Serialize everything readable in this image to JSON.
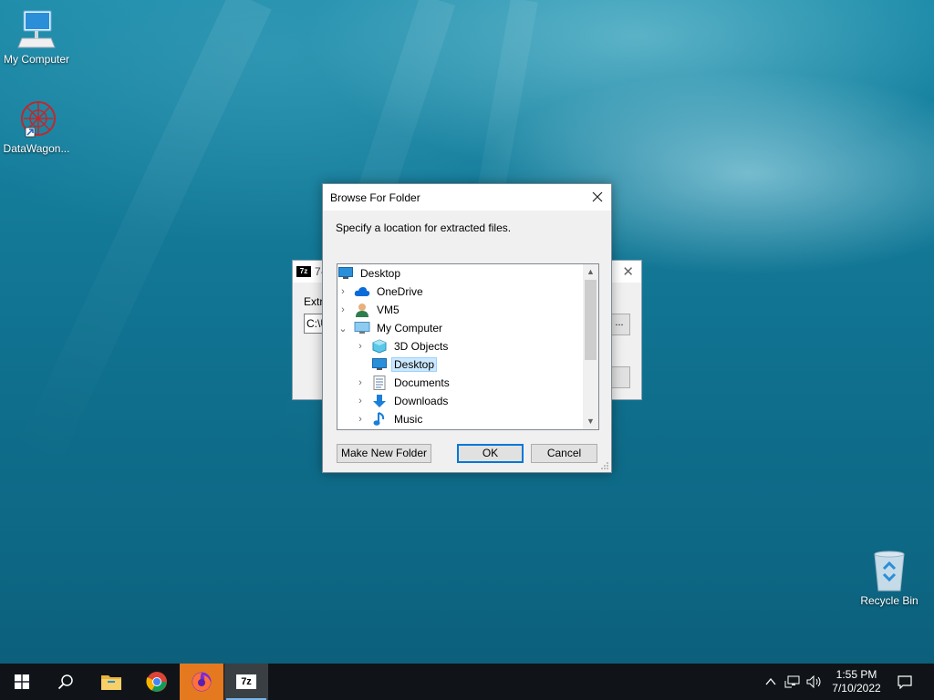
{
  "desktop": {
    "icons": [
      {
        "label": "My Computer",
        "icon": "computer-icon"
      },
      {
        "label": "DataWagon...",
        "icon": "datawagon-icon"
      },
      {
        "label": "Recycle Bin",
        "icon": "recycle-bin-icon"
      }
    ]
  },
  "bg_window": {
    "title": "7-",
    "logo": "7z",
    "label_partial": "Extra",
    "path_partial": "C:\\U",
    "browse_label": "..."
  },
  "dialog": {
    "title": "Browse For Folder",
    "prompt": "Specify a location for extracted files.",
    "tree": [
      {
        "label": "Desktop",
        "icon": "desktop-icon",
        "expander": "none",
        "level": 0,
        "selected": false
      },
      {
        "label": "OneDrive",
        "icon": "onedrive-icon",
        "expander": "collapsed",
        "level": 1,
        "selected": false
      },
      {
        "label": "VM5",
        "icon": "user-icon",
        "expander": "collapsed",
        "level": 1,
        "selected": false
      },
      {
        "label": "My Computer",
        "icon": "computer-icon",
        "expander": "expanded",
        "level": 1,
        "selected": false
      },
      {
        "label": "3D Objects",
        "icon": "3d-objects-icon",
        "expander": "collapsed",
        "level": 2,
        "selected": false
      },
      {
        "label": "Desktop",
        "icon": "desktop-icon",
        "expander": "none",
        "level": 2,
        "selected": true
      },
      {
        "label": "Documents",
        "icon": "documents-icon",
        "expander": "collapsed",
        "level": 2,
        "selected": false
      },
      {
        "label": "Downloads",
        "icon": "downloads-icon",
        "expander": "collapsed",
        "level": 2,
        "selected": false
      },
      {
        "label": "Music",
        "icon": "music-icon",
        "expander": "collapsed",
        "level": 2,
        "selected": false
      }
    ],
    "buttons": {
      "new_folder": "Make New Folder",
      "ok": "OK",
      "cancel": "Cancel"
    }
  },
  "taskbar": {
    "apps": [
      {
        "name": "start",
        "icon": "windows-start-icon"
      },
      {
        "name": "search",
        "icon": "search-icon"
      },
      {
        "name": "file-explorer",
        "icon": "folder-icon"
      },
      {
        "name": "chrome",
        "icon": "chrome-icon"
      },
      {
        "name": "firefox",
        "icon": "firefox-icon"
      },
      {
        "name": "7zip",
        "icon": "7zip-icon",
        "label": "7z"
      }
    ],
    "clock": {
      "time": "1:55 PM",
      "date": "7/10/2022"
    }
  },
  "colors": {
    "accent": "#0078d7",
    "selection_bg": "#cce8ff",
    "taskbar_bg": "#101418",
    "firefox_active": "#e5791f"
  }
}
